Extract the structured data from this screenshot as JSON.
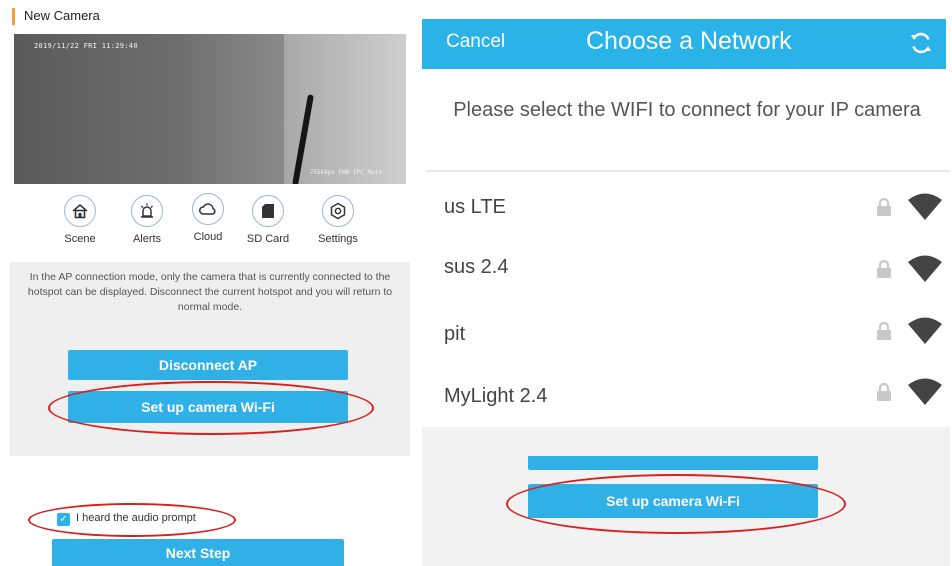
{
  "left": {
    "title": "New Camera",
    "video": {
      "timestamp": "2019/11/22  FRI  11:29:40",
      "stream_info": "755kbps  FHD  IPC Main"
    },
    "quick_actions": [
      {
        "label": "Scene",
        "icon": "home-icon"
      },
      {
        "label": "Alerts",
        "icon": "alarm-icon"
      },
      {
        "label": "Cloud",
        "icon": "cloud-icon"
      },
      {
        "label": "SD Card",
        "icon": "sd-card-icon"
      },
      {
        "label": "Settings",
        "icon": "gear-icon"
      }
    ],
    "ap_message": "In the AP connection mode, only the camera that is currently connected to the hotspot can be displayed. Disconnect the current hotspot and you will return to normal mode.",
    "disconnect_label": "Disconnect AP",
    "setup_wifi_label": "Set up camera Wi-Fi",
    "audio_prompt_label": "I heard the audio prompt",
    "next_step_label": "Next Step"
  },
  "right": {
    "cancel_label": "Cancel",
    "title": "Choose a Network",
    "prompt": "Please select the WIFI to connect for your IP camera",
    "networks": [
      {
        "ssid": "us LTE"
      },
      {
        "ssid": "sus 2.4"
      },
      {
        "ssid": "pit"
      },
      {
        "ssid": "MyLight  2.4"
      }
    ],
    "setup_wifi_label": "Set up camera Wi-Fi"
  },
  "colors": {
    "accent_blue": "#2fb1e8",
    "header_blue": "#29b3e8",
    "annotation_red": "#d8201d",
    "title_marker": "#f0a43a"
  }
}
